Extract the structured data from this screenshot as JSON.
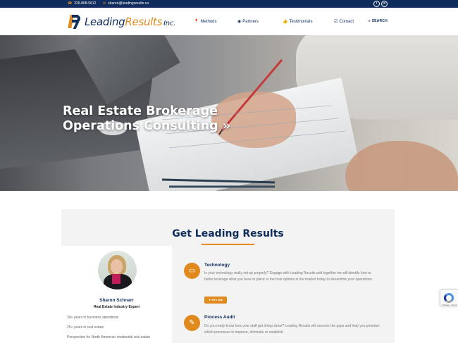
{
  "topbar": {
    "phone": "226-808-5612",
    "email": "sharon@leadingresults.ca",
    "social": [
      "twitter-icon",
      "linkedin-icon"
    ]
  },
  "brand": {
    "name_part1": "Leading",
    "name_part2": "Results",
    "suffix": "Inc.",
    "colors": {
      "navy": "#0f2d5c",
      "orange": "#e08a1e"
    }
  },
  "nav": {
    "items": [
      {
        "label": "Methods",
        "icon": "map-pin-icon"
      },
      {
        "label": "Partners",
        "icon": "eye-icon"
      },
      {
        "label": "Testimonials",
        "icon": "thumbs-up-icon"
      },
      {
        "label": "Contact",
        "icon": "check-square-icon"
      }
    ],
    "search_label": "SEARCH"
  },
  "hero": {
    "headline_line1": "Real Estate Brokerage",
    "headline_line2": "Operations Consulting",
    "chevron": "»"
  },
  "section": {
    "title": "Get Leading Results"
  },
  "profile": {
    "name": "Sharon Schnarr",
    "role": "Real Estate Industry Expert",
    "facts": [
      "30+ years in business operations",
      "25+ years in real estate",
      "Perspective for North American residential real estate"
    ]
  },
  "features": [
    {
      "title": "Technology",
      "icon": "laptop-icon",
      "text": "Is your technology really set-up properly? Engage with Leading Results and together we will identify how to better leverage what you have in place or the best options in the market today to streamline your operations.",
      "button": "let's talk"
    },
    {
      "title": "Process Audit",
      "icon": "clipboard-icon",
      "text": "Do you really know how your staff get things done? Leading Results will uncover the gaps and help you prioritize which processes to improve, eliminate or establish."
    }
  ],
  "recaptcha": {
    "text": "Privacy - Terms"
  }
}
